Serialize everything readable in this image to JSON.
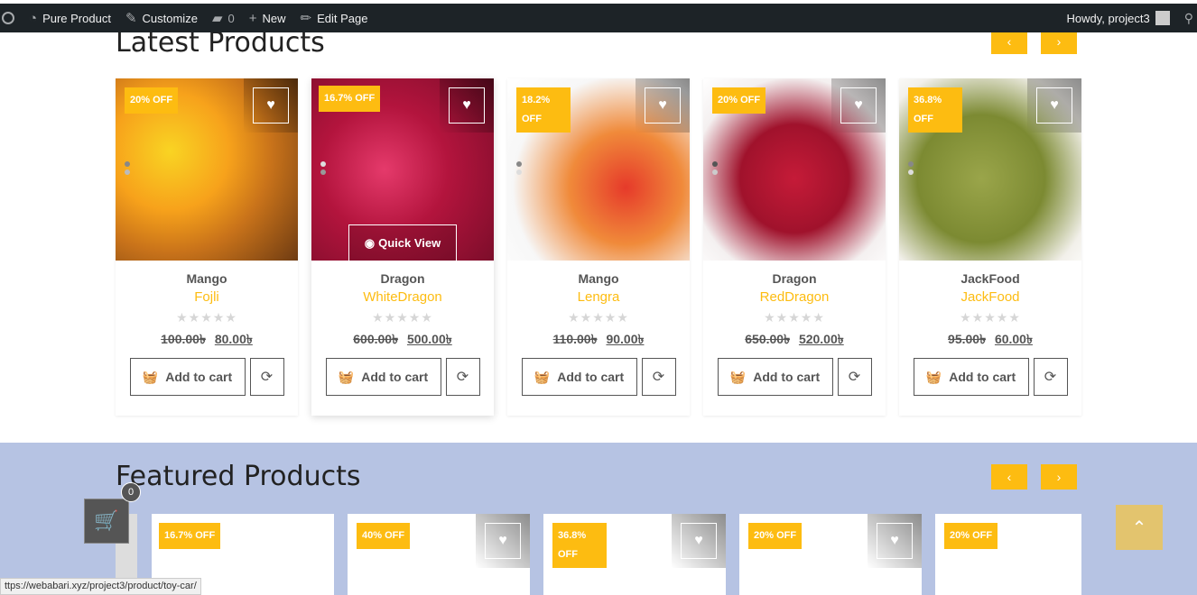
{
  "adminbar": {
    "site_name": "Pure Product",
    "customize": "Customize",
    "comments_count": "0",
    "new_label": "New",
    "edit_page": "Edit Page",
    "howdy": "Howdy, project3"
  },
  "latest": {
    "title": "Latest Products",
    "prev": "‹",
    "next": "›",
    "products": [
      {
        "badge": "20% OFF",
        "category": "Mango",
        "name": "Fojli",
        "old_price": "100.00৳",
        "new_price": "80.00৳",
        "add_to_cart": "Add to cart"
      },
      {
        "badge": "16.7% OFF",
        "category": "Dragon",
        "name": "WhiteDragon",
        "old_price": "600.00৳",
        "new_price": "500.00৳",
        "add_to_cart": "Add to cart",
        "quick_view": "Quick View"
      },
      {
        "badge": "18.2% OFF",
        "category": "Mango",
        "name": "Lengra",
        "old_price": "110.00৳",
        "new_price": "90.00৳",
        "add_to_cart": "Add to cart"
      },
      {
        "badge": "20% OFF",
        "category": "Dragon",
        "name": "RedDragon",
        "old_price": "650.00৳",
        "new_price": "520.00৳",
        "add_to_cart": "Add to cart"
      },
      {
        "badge": "36.8% OFF",
        "category": "JackFood",
        "name": "JackFood",
        "old_price": "95.00৳",
        "new_price": "60.00৳",
        "add_to_cart": "Add to cart"
      }
    ]
  },
  "featured": {
    "title": "Featured Products",
    "prev": "‹",
    "next": "›",
    "badges": [
      "16.7% OFF",
      "40% OFF",
      "36.8% OFF",
      "20% OFF",
      "20% OFF"
    ]
  },
  "cart": {
    "count": "0"
  },
  "status_url": "ttps://webabari.xyz/project3/product/toy-car/"
}
